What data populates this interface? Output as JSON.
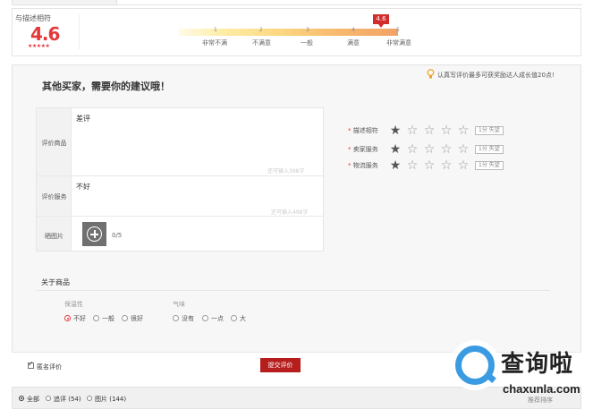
{
  "summary": {
    "title": "与描述相符",
    "score": "4.6",
    "stars": "★★★★★",
    "marker": "4.6",
    "ticks": [
      "1",
      "2",
      "3",
      "4",
      "5"
    ],
    "labels": [
      "非常不满",
      "不满意",
      "一般",
      "满意",
      "非常满意"
    ]
  },
  "tip": {
    "text": "认真写评价最多可获奖励达人成长值20点!"
  },
  "heading": "其他买家，需要你的建议哦！",
  "form": {
    "product": {
      "label": "评价商品",
      "value": "差评",
      "counter": "还可输入398字"
    },
    "service": {
      "label": "评价服务",
      "value": "不好",
      "counter": "还可输入498字"
    },
    "photos": {
      "label": "晒图片",
      "count": "0/5"
    }
  },
  "ratings": [
    {
      "label": "描述相符",
      "stars": 1,
      "tag": "1分 失望"
    },
    {
      "label": "卖家服务",
      "stars": 1,
      "tag": "1分 失望"
    },
    {
      "label": "物流服务",
      "stars": 1,
      "tag": "1分 失望"
    }
  ],
  "required_mark": "*",
  "about": {
    "title": "关于商品",
    "groups": [
      {
        "label": "保温性",
        "options": [
          "不好",
          "一般",
          "很好"
        ],
        "selected": 0
      },
      {
        "label": "气味",
        "options": [
          "没有",
          "一点",
          "大"
        ],
        "selected": -1
      }
    ]
  },
  "bottom": {
    "anonymous_label": "匿名评价",
    "anonymous_checked": true,
    "submit_label": "提交评价"
  },
  "filter": {
    "options": [
      "全部",
      "追评 (54)",
      "图片 (144)"
    ],
    "selected": 0,
    "right_text": "推荐排序"
  },
  "watermark": {
    "cn": "查询啦",
    "en": "chaxunla.com"
  },
  "colors": {
    "accent_red": "#e4393c",
    "submit_red": "#b61d1d",
    "watermark_blue": "#3a9be2"
  }
}
